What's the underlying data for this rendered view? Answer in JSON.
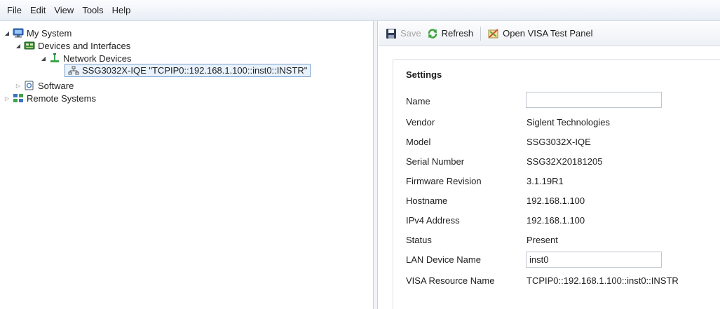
{
  "menu": {
    "file": "File",
    "edit": "Edit",
    "view": "View",
    "tools": "Tools",
    "help": "Help"
  },
  "tree": {
    "my_system": "My System",
    "devices_and_interfaces": "Devices and Interfaces",
    "network_devices": "Network Devices",
    "device": "SSG3032X-IQE \"TCPIP0::192.168.1.100::inst0::INSTR\"",
    "software": "Software",
    "remote_systems": "Remote Systems"
  },
  "toolbar": {
    "save_label": "Save",
    "refresh_label": "Refresh",
    "open_visa_label": "Open VISA Test Panel"
  },
  "settings": {
    "title": "Settings",
    "name_label": "Name",
    "name_value": "",
    "vendor_label": "Vendor",
    "vendor_value": "Siglent Technologies",
    "model_label": "Model",
    "model_value": "SSG3032X-IQE",
    "serial_label": "Serial Number",
    "serial_value": "SSG32X20181205",
    "firmware_label": "Firmware Revision",
    "firmware_value": "3.1.19R1",
    "hostname_label": "Hostname",
    "hostname_value": "192.168.1.100",
    "ipv4_label": "IPv4 Address",
    "ipv4_value": "192.168.1.100",
    "status_label": "Status",
    "status_value": "Present",
    "lan_label": "LAN Device Name",
    "lan_value": "inst0",
    "visa_label": "VISA Resource Name",
    "visa_value": "TCPIP0::192.168.1.100::inst0::INSTR"
  },
  "icons": {
    "my_system": "computer-icon",
    "devices": "devices-board-icon",
    "network": "network-icon",
    "device": "network-device-icon",
    "software": "software-icon",
    "remote": "remote-systems-icon",
    "save": "save-icon",
    "refresh": "refresh-icon",
    "visa": "visa-panel-icon"
  },
  "colors": {
    "selection_bg": "#e8f2fd",
    "selection_border": "#7da2ce",
    "refresh_green": "#3aa33a"
  }
}
